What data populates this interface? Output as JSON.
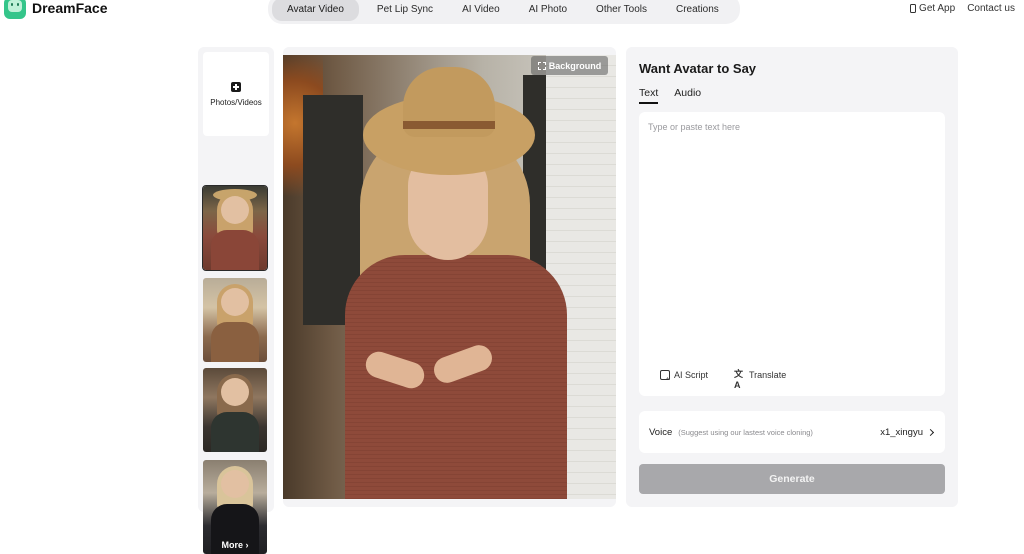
{
  "brand": {
    "name": "DreamFace",
    "accent": "#34c58a"
  },
  "nav": {
    "items": [
      {
        "label": "Avatar Video",
        "active": true
      },
      {
        "label": "Pet Lip Sync",
        "active": false
      },
      {
        "label": "AI Video",
        "active": false
      },
      {
        "label": "AI Photo",
        "active": false
      },
      {
        "label": "Other Tools",
        "active": false
      },
      {
        "label": "Creations",
        "active": false
      }
    ]
  },
  "header_links": {
    "get_app": "Get App",
    "contact": "Contact us"
  },
  "sidebar": {
    "upload_label": "Photos/Videos",
    "upload_icon": "plus-icon",
    "more_label": "More"
  },
  "preview": {
    "background_button": "Background"
  },
  "panel": {
    "title": "Want Avatar to Say",
    "tabs": [
      {
        "label": "Text",
        "active": true
      },
      {
        "label": "Audio",
        "active": false
      }
    ],
    "text_placeholder": "Type or paste text here",
    "tools": {
      "ai_script": "AI Script",
      "translate": "Translate"
    },
    "voice": {
      "label": "Voice",
      "hint": "(Suggest using our lastest voice cloning)",
      "value": "x1_xingyu"
    },
    "generate_label": "Generate"
  }
}
